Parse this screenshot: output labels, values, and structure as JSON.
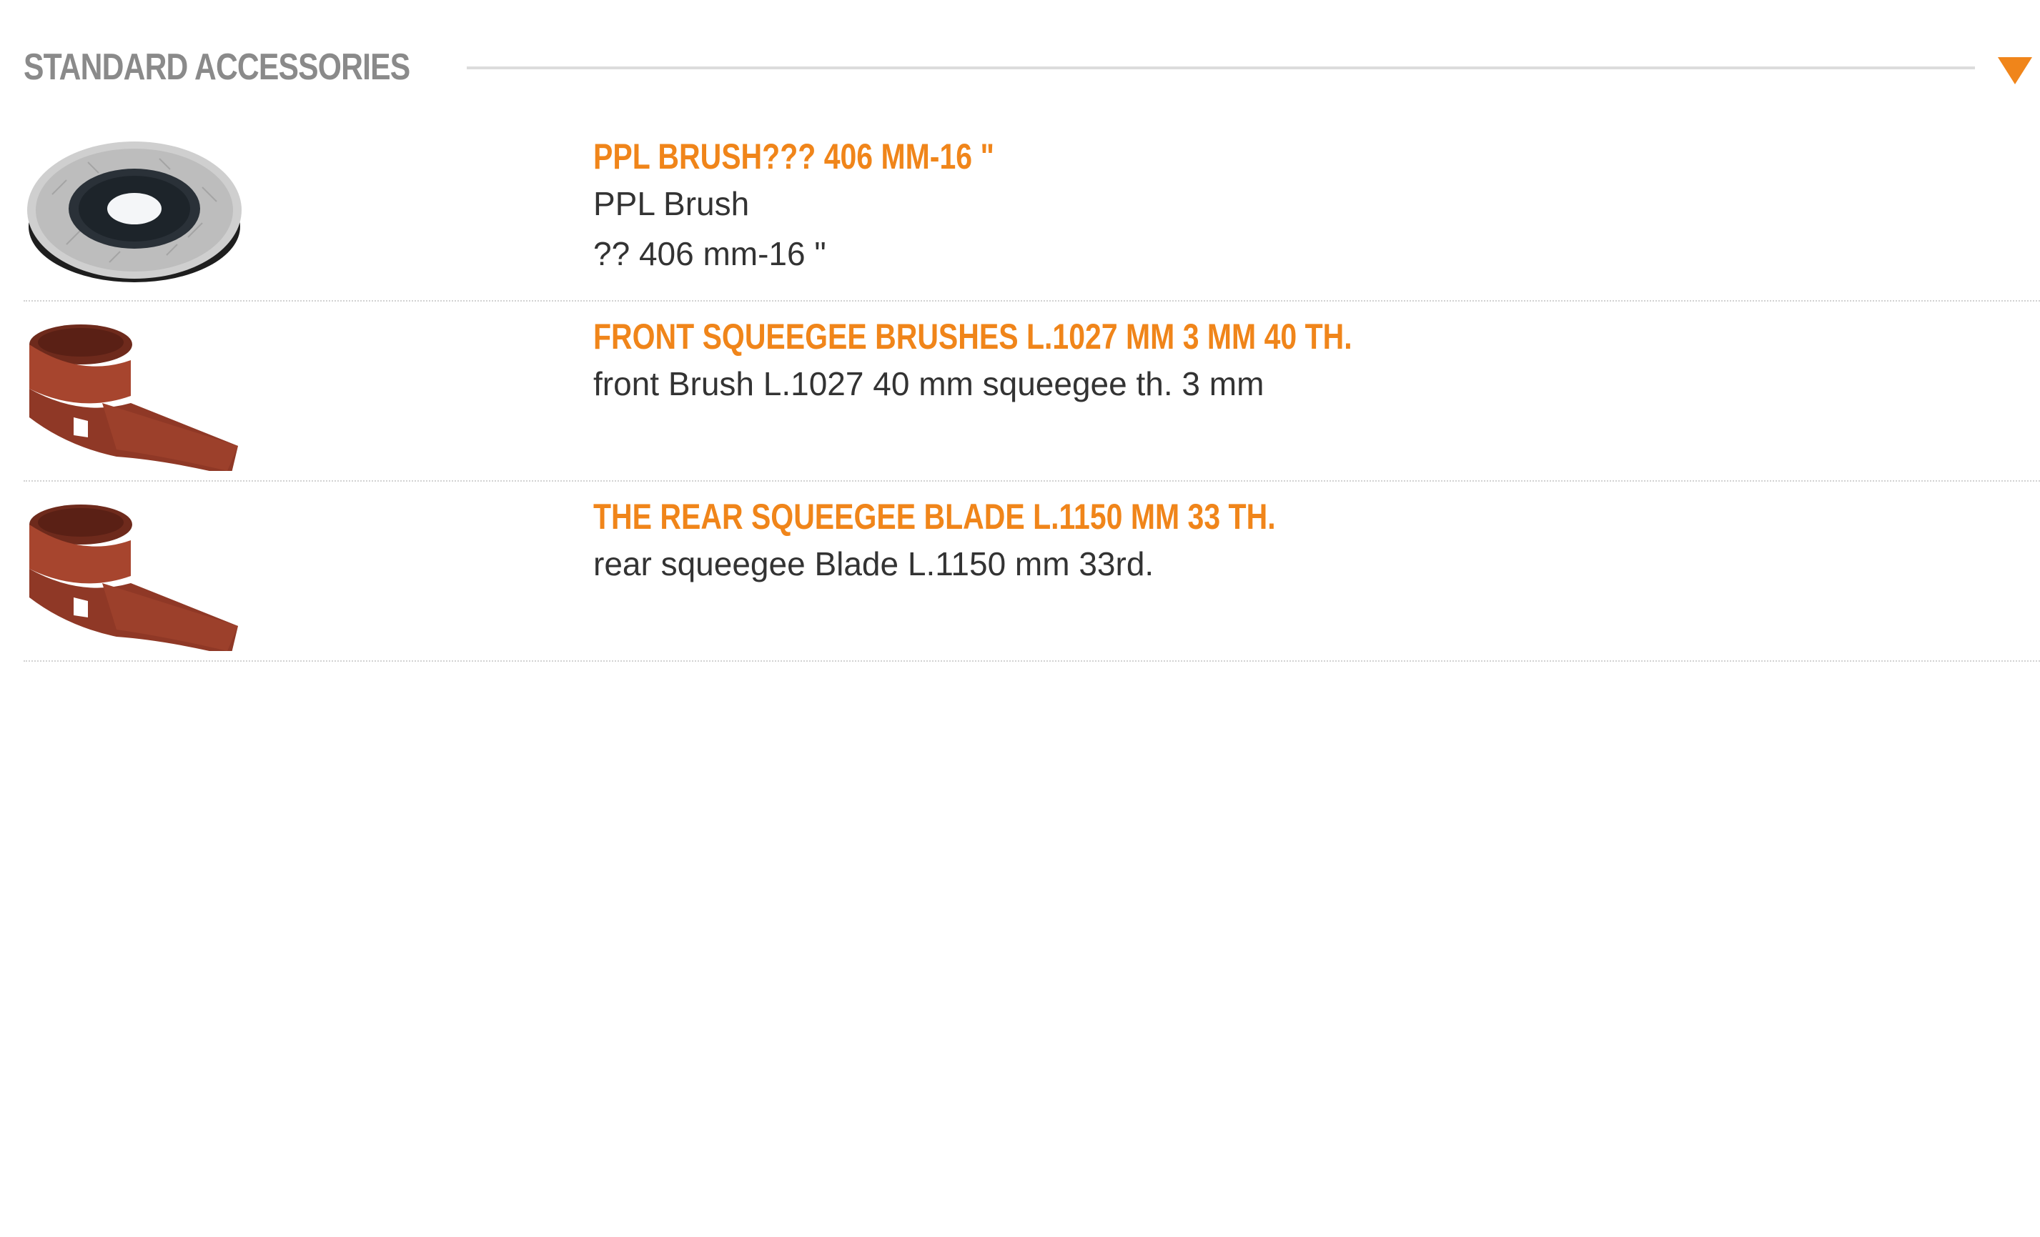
{
  "section": {
    "title": "STANDARD ACCESSORIES",
    "toggle_icon": "triangle-down-icon"
  },
  "colors": {
    "accent": "#f0851a",
    "heading_gray": "#8a8a8a",
    "body_text": "#333333",
    "divider": "#d2d2d2"
  },
  "items": [
    {
      "title": "PPL BRUSH??? 406 MM-16 \"",
      "lines": [
        "PPL Brush",
        "?? 406 mm-16 \""
      ],
      "image": "brush-disc-image"
    },
    {
      "title": "FRONT SQUEEGEE BRUSHES L.1027 MM 3 MM 40 TH.",
      "lines": [
        "front Brush L.1027 40 mm squeegee th. 3 mm"
      ],
      "image": "squeegee-blade-image"
    },
    {
      "title": "THE REAR SQUEEGEE BLADE L.1150 MM 33 TH.",
      "lines": [
        "rear squeegee Blade L.1150 mm 33rd."
      ],
      "image": "squeegee-blade-image"
    }
  ]
}
